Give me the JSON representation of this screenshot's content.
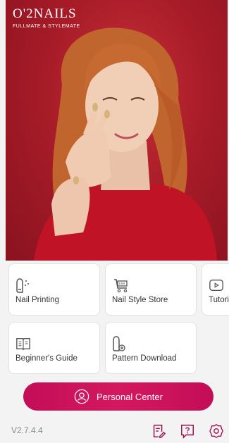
{
  "brand": {
    "title": "O'2NAILS",
    "subtitle": "FULLMATE & STYLEMATE"
  },
  "colors": {
    "accent": "#c8105a",
    "hero_background": "#a81c28",
    "icon_outline": "#555555"
  },
  "tiles": [
    {
      "label": "Nail Printing",
      "icon": "nail-printing-icon"
    },
    {
      "label": "Nail Style Store",
      "icon": "cart-icon"
    },
    {
      "label": "Tutori",
      "icon": "play-icon"
    },
    {
      "label": "Beginner's Guide",
      "icon": "book-icon"
    },
    {
      "label": "Pattern Download",
      "icon": "pattern-download-icon"
    }
  ],
  "personal_center": {
    "label": "Personal Center",
    "icon": "user-icon"
  },
  "footer": {
    "version": "V2.7.4.4",
    "icons": [
      "edit-note-icon",
      "help-icon",
      "settings-icon"
    ]
  }
}
